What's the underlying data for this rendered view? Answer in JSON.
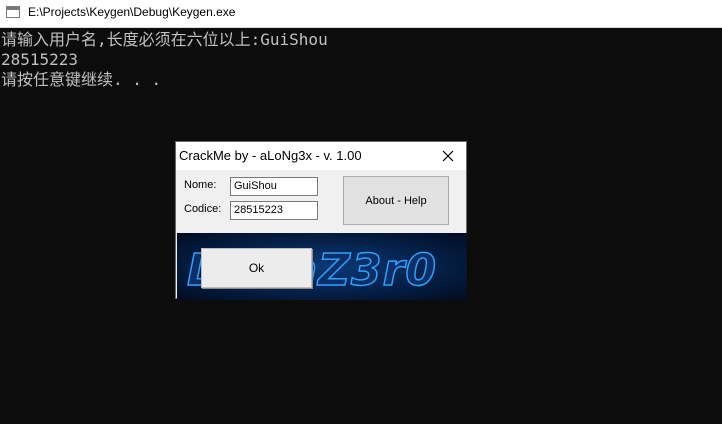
{
  "console": {
    "title": "E:\\Projects\\Keygen\\Debug\\Keygen.exe",
    "lines": [
      "请输入用户名,长度必须在六位以上:GuiShou",
      "28515223",
      "请按任意键继续. . ."
    ]
  },
  "dialog": {
    "title": "CrackMe by - aLoNg3x - v. 1.00",
    "nome_label": "Nome:",
    "nome_value": "GuiShou",
    "codice_label": "Codice:",
    "codice_value": "28515223",
    "about_button": "About - Help",
    "ok_button": "Ok",
    "banner_text": "DiamZ3r0"
  },
  "icons": {
    "console": "console-window-icon",
    "close": "close-icon"
  },
  "colors": {
    "console_bg": "#0c0c0c",
    "console_text": "#c0c0c0",
    "banner_bg": "#021a3a",
    "banner_glow": "#1b8cff"
  }
}
